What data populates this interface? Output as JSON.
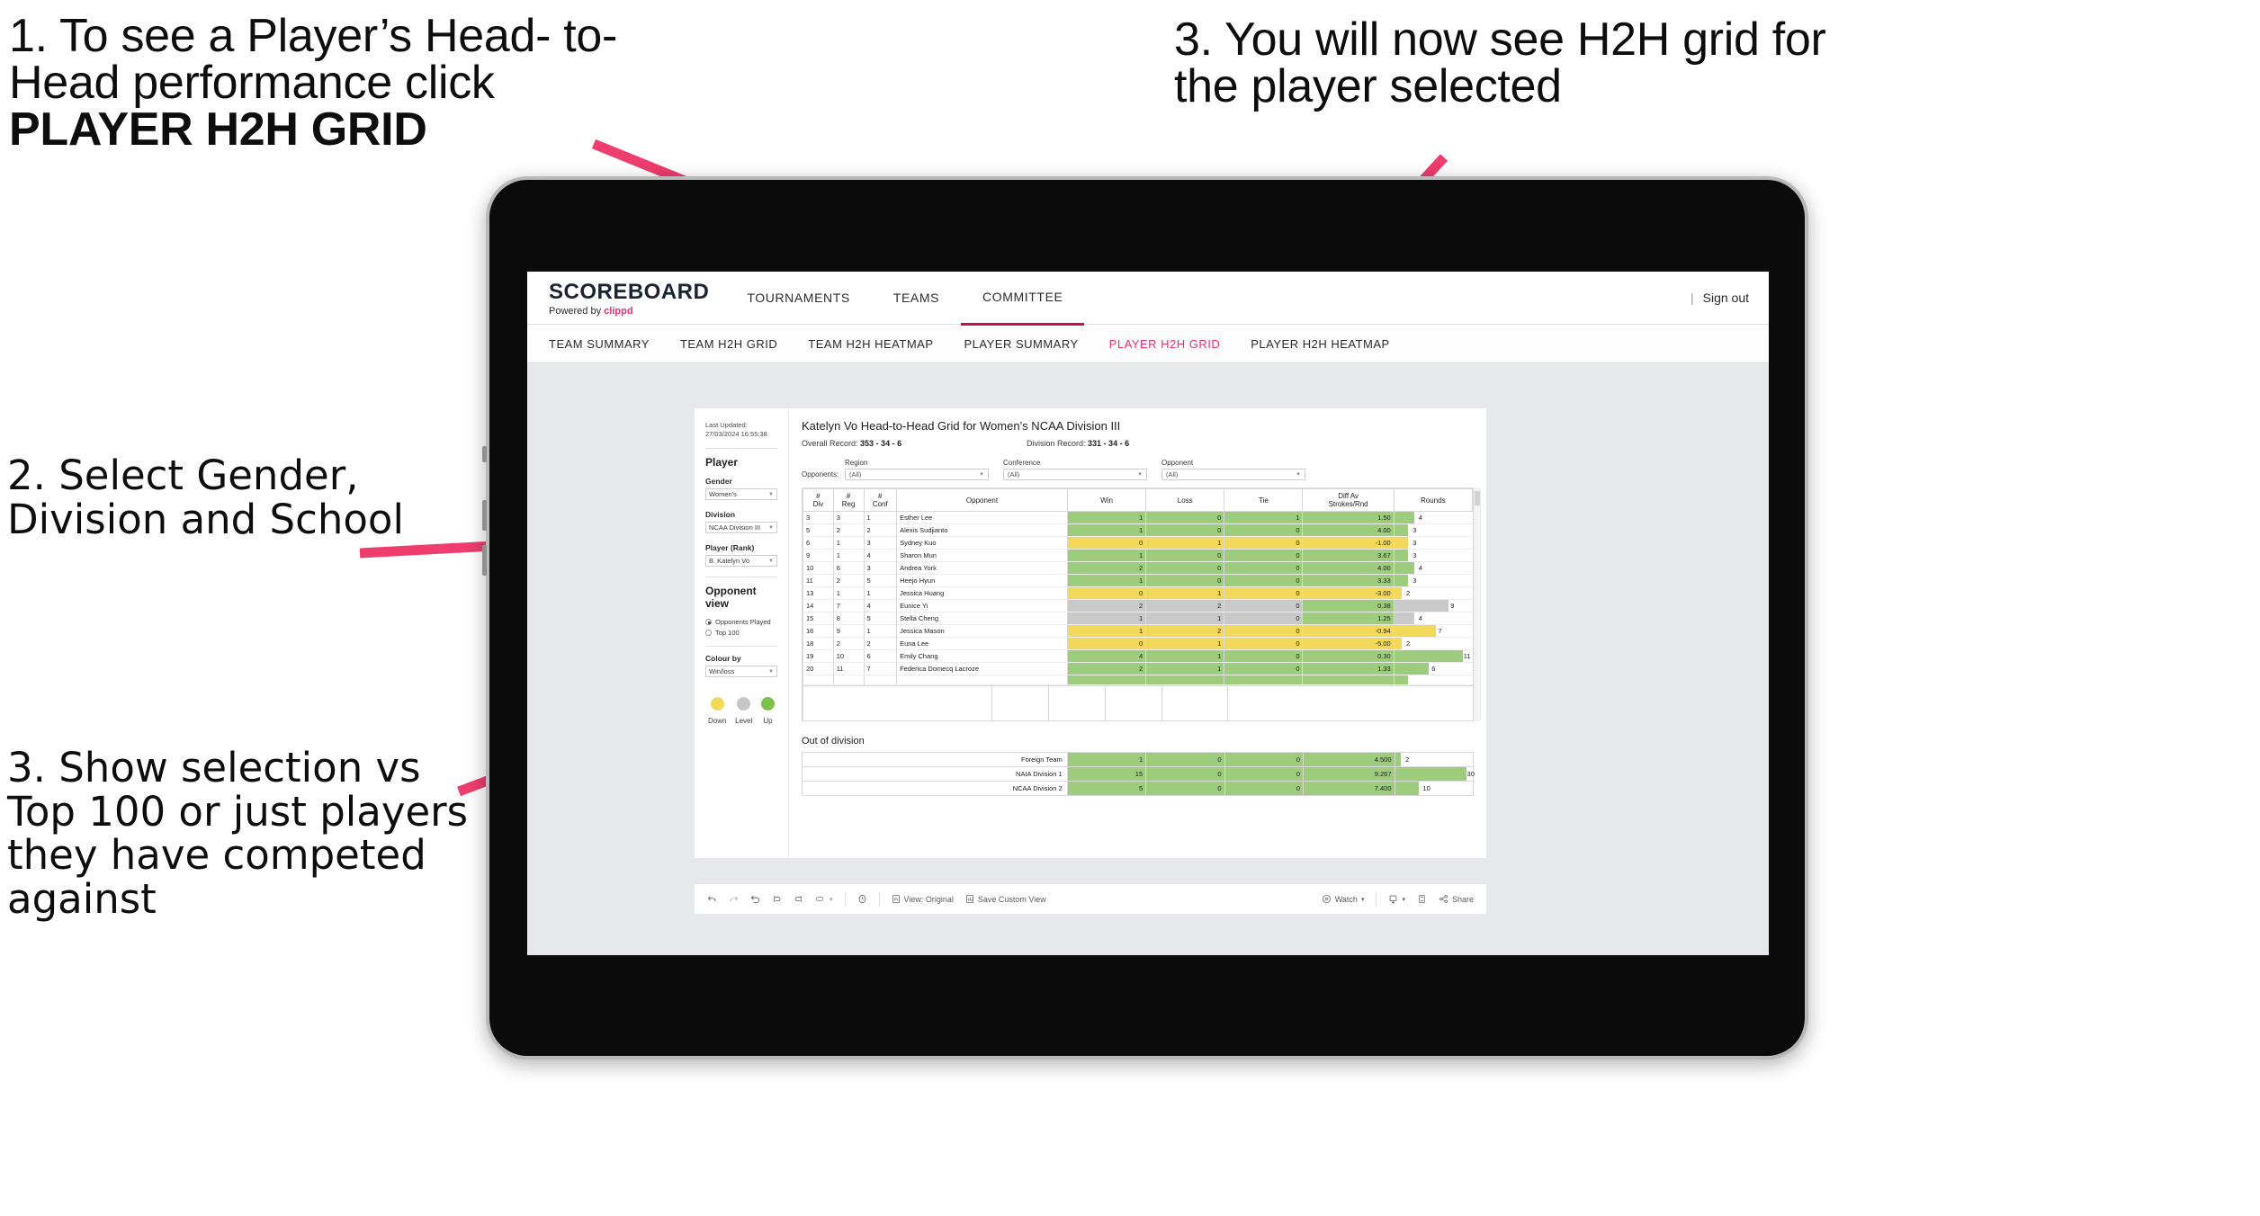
{
  "annotations": [
    {
      "id": "a1",
      "line1": "1. To see a Player’s Head-",
      "line2": "to-Head performance click",
      "bold": "PLAYER H2H GRID"
    },
    {
      "id": "a2",
      "text": "3. You will now see H2H grid for the player selected"
    },
    {
      "id": "a3",
      "text": "2. Select Gender, Division and School"
    },
    {
      "id": "a4",
      "text": "3. Show selection vs Top 100 or just players they have competed against"
    }
  ],
  "app": {
    "brand": {
      "word": "SCOREBOARD",
      "powered_prefix": "Powered by ",
      "powered_name": "clippd"
    },
    "nav": [
      {
        "label": "TOURNAMENTS",
        "active": false
      },
      {
        "label": "TEAMS",
        "active": false
      },
      {
        "label": "COMMITTEE",
        "active": true
      }
    ],
    "right": {
      "sep": "|",
      "signout": "Sign out"
    },
    "subnav": [
      {
        "label": "TEAM SUMMARY",
        "active": false
      },
      {
        "label": "TEAM H2H GRID",
        "active": false
      },
      {
        "label": "TEAM H2H HEATMAP",
        "active": false
      },
      {
        "label": "PLAYER SUMMARY",
        "active": false
      },
      {
        "label": "PLAYER H2H GRID",
        "active": true
      },
      {
        "label": "PLAYER H2H HEATMAP",
        "active": false
      }
    ]
  },
  "sidebar": {
    "last_updated": "Last Updated: 27/03/2024 16:55:38",
    "player_section_title": "Player",
    "gender": {
      "label": "Gender",
      "value": "Women's"
    },
    "division": {
      "label": "Division",
      "value": "NCAA Division III"
    },
    "player_rank": {
      "label": "Player (Rank)",
      "value": "B. Katelyn Vo"
    },
    "opponent_view": {
      "title": "Opponent view",
      "options": [
        {
          "label": "Opponents Played",
          "selected": true
        },
        {
          "label": "Top 100",
          "selected": false
        }
      ]
    },
    "colour_by": {
      "label": "Colour by",
      "value": "Win/loss"
    },
    "legend": [
      {
        "label": "Down",
        "color": "#F2D95C"
      },
      {
        "label": "Level",
        "color": "#C6C6C6"
      },
      {
        "label": "Up",
        "color": "#7EC14A"
      }
    ]
  },
  "main": {
    "title": "Katelyn Vo Head-to-Head Grid for Women’s NCAA Division III",
    "overall_record_label": "Overall Record:",
    "overall_record": "353 - 34 - 6",
    "division_record_label": "Division Record:",
    "division_record": "331 - 34 - 6",
    "opponents_label": "Opponents:",
    "filters": [
      {
        "label": "Region",
        "value": "(All)"
      },
      {
        "label": "Conference",
        "value": "(All)"
      },
      {
        "label": "Opponent",
        "value": "(All)"
      }
    ],
    "columns": [
      "# Div",
      "# Reg",
      "# Conf",
      "Opponent",
      "Win",
      "Loss",
      "Tie",
      "Diff Av Strokes/Rnd",
      "Rounds"
    ],
    "rows": [
      {
        "div": "3",
        "reg": "3",
        "conf": "1",
        "opponent": "Esther Lee",
        "win": "1",
        "loss": "0",
        "tie": "1",
        "diff": "1.50",
        "rounds": "4",
        "state": "up",
        "bar_pct": 26
      },
      {
        "div": "5",
        "reg": "2",
        "conf": "2",
        "opponent": "Alexis Sudjianto",
        "win": "1",
        "loss": "0",
        "tie": "0",
        "diff": "4.00",
        "rounds": "3",
        "state": "up",
        "bar_pct": 18
      },
      {
        "div": "6",
        "reg": "1",
        "conf": "3",
        "opponent": "Sydney Kuo",
        "win": "0",
        "loss": "1",
        "tie": "0",
        "diff": "-1.00",
        "rounds": "3",
        "state": "down",
        "bar_pct": 18
      },
      {
        "div": "9",
        "reg": "1",
        "conf": "4",
        "opponent": "Sharon Mun",
        "win": "1",
        "loss": "0",
        "tie": "0",
        "diff": "3.67",
        "rounds": "3",
        "state": "up",
        "bar_pct": 18
      },
      {
        "div": "10",
        "reg": "6",
        "conf": "3",
        "opponent": "Andrea York",
        "win": "2",
        "loss": "0",
        "tie": "0",
        "diff": "4.00",
        "rounds": "4",
        "state": "up",
        "bar_pct": 26
      },
      {
        "div": "11",
        "reg": "2",
        "conf": "5",
        "opponent": "Heejo Hyun",
        "win": "1",
        "loss": "0",
        "tie": "0",
        "diff": "3.33",
        "rounds": "3",
        "state": "up",
        "bar_pct": 18
      },
      {
        "div": "13",
        "reg": "1",
        "conf": "1",
        "opponent": "Jessica Huang",
        "win": "0",
        "loss": "1",
        "tie": "0",
        "diff": "-3.00",
        "rounds": "2",
        "state": "down",
        "bar_pct": 9
      },
      {
        "div": "14",
        "reg": "7",
        "conf": "4",
        "opponent": "Eunice Yi",
        "win": "2",
        "loss": "2",
        "tie": "0",
        "diff": "0.38",
        "rounds": "9",
        "state": "level",
        "bar_pct": 70,
        "diff_state": "up"
      },
      {
        "div": "15",
        "reg": "8",
        "conf": "5",
        "opponent": "Stella Cheng",
        "win": "1",
        "loss": "1",
        "tie": "0",
        "diff": "1.25",
        "rounds": "4",
        "state": "level",
        "bar_pct": 26,
        "diff_state": "up"
      },
      {
        "div": "16",
        "reg": "9",
        "conf": "1",
        "opponent": "Jessica Mason",
        "win": "1",
        "loss": "2",
        "tie": "0",
        "diff": "-0.94",
        "rounds": "7",
        "state": "down",
        "bar_pct": 53
      },
      {
        "div": "18",
        "reg": "2",
        "conf": "2",
        "opponent": "Euna Lee",
        "win": "0",
        "loss": "1",
        "tie": "0",
        "diff": "-5.00",
        "rounds": "2",
        "state": "down",
        "bar_pct": 9
      },
      {
        "div": "19",
        "reg": "10",
        "conf": "6",
        "opponent": "Emily Chang",
        "win": "4",
        "loss": "1",
        "tie": "0",
        "diff": "0.30",
        "rounds": "11",
        "state": "up",
        "bar_pct": 88
      },
      {
        "div": "20",
        "reg": "11",
        "conf": "7",
        "opponent": "Federica Domecq Lacroze",
        "win": "2",
        "loss": "1",
        "tie": "0",
        "diff": "1.33",
        "rounds": "6",
        "state": "up",
        "bar_pct": 44
      }
    ],
    "out_of_division": {
      "title": "Out of division",
      "rows": [
        {
          "label": "Foreign Team",
          "win": "1",
          "loss": "0",
          "tie": "0",
          "diff": "4.500",
          "rounds": "2",
          "state": "up",
          "bar_pct": 7
        },
        {
          "label": "NAIA Division 1",
          "win": "15",
          "loss": "0",
          "tie": "0",
          "diff": "9.267",
          "rounds": "30",
          "state": "up",
          "bar_pct": 92
        },
        {
          "label": "NCAA Division 2",
          "win": "5",
          "loss": "0",
          "tie": "0",
          "diff": "7.400",
          "rounds": "10",
          "state": "up",
          "bar_pct": 31
        }
      ]
    }
  },
  "toolbar": {
    "undo": "undo-icon",
    "redo": "redo-icon",
    "revert": "revert-icon",
    "refresh": "refresh-icon",
    "pause": "pause-icon",
    "highlight": "highlight-icon",
    "highlight_caret": "▾",
    "view_original": "View: Original",
    "save_custom_view": "Save Custom View",
    "watch": "Watch",
    "watch_caret": "▾",
    "download_caret": "▾",
    "share": "Share"
  },
  "colors": {
    "accent_pink": "#e8336d",
    "active_tab": "#c2144b",
    "up": "#9CCC7C",
    "down": "#F2D95C",
    "level": "#C9C9C9",
    "arrow": "#ee3d6e"
  }
}
